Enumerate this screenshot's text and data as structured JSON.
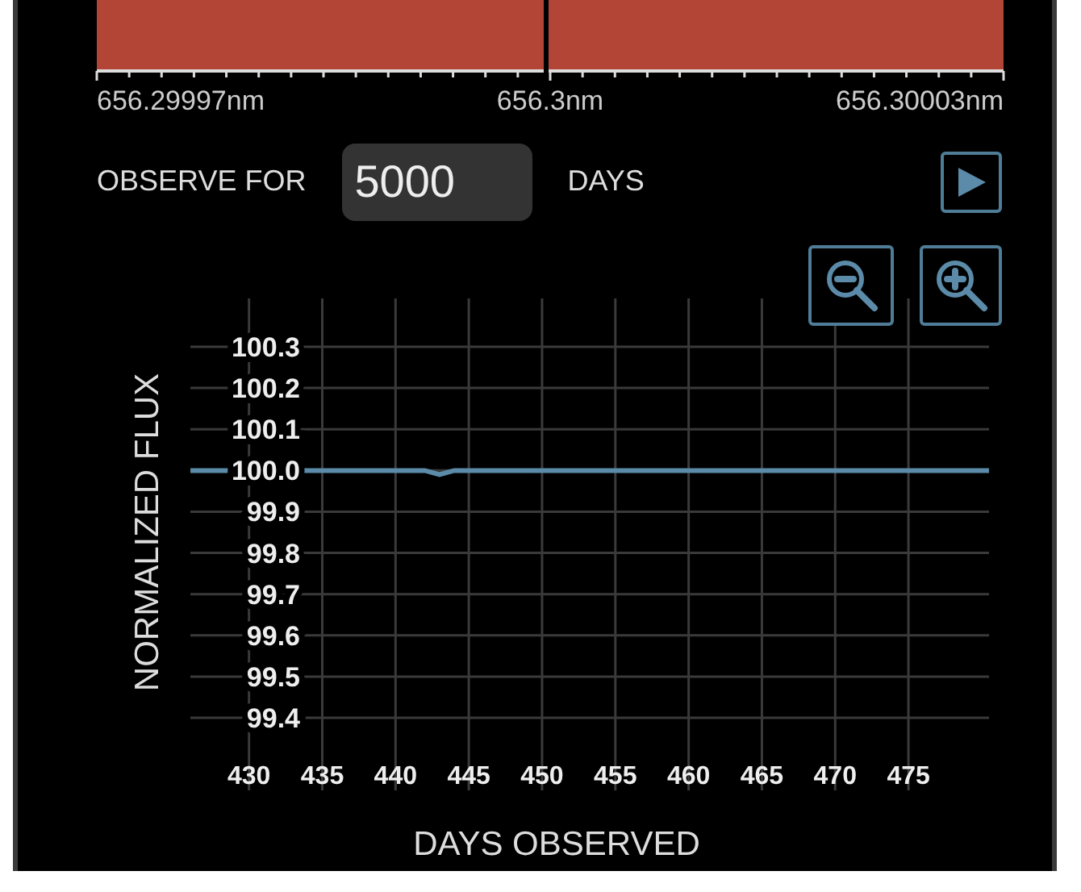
{
  "spectrum": {
    "labels": [
      "656.29997nm",
      "656.3nm",
      "656.30003nm"
    ]
  },
  "observe": {
    "label": "OBSERVE FOR",
    "value": "5000",
    "unit": "DAYS"
  },
  "chart": {
    "chart_data": {
      "type": "line",
      "xlabel": "DAYS OBSERVED",
      "ylabel": "NORMALIZED FLUX",
      "x": [
        426,
        442,
        443,
        444,
        480.5
      ],
      "series": [
        {
          "color": "#5b8ba8",
          "values": [
            100,
            100,
            99.99,
            100,
            100
          ]
        }
      ],
      "xlim": [
        426,
        480.5
      ],
      "ylim": [
        99.4,
        100.3
      ],
      "grid": true,
      "xticks": [
        430,
        435,
        440,
        445,
        450,
        455,
        460,
        465,
        470,
        475
      ],
      "yticks": [
        {
          "value": 100.3,
          "label": "100.3"
        },
        {
          "value": 100.2,
          "label": "100.2"
        },
        {
          "value": 100.1,
          "label": "100.1"
        },
        {
          "value": 100,
          "label": "100.0"
        },
        {
          "value": 99.9,
          "label": "99.9"
        },
        {
          "value": 99.8,
          "label": "99.8"
        },
        {
          "value": 99.7,
          "label": "99.7"
        },
        {
          "value": 99.6,
          "label": "99.6"
        },
        {
          "value": 99.5,
          "label": "99.5"
        },
        {
          "value": 99.4,
          "label": "99.4"
        }
      ]
    }
  }
}
